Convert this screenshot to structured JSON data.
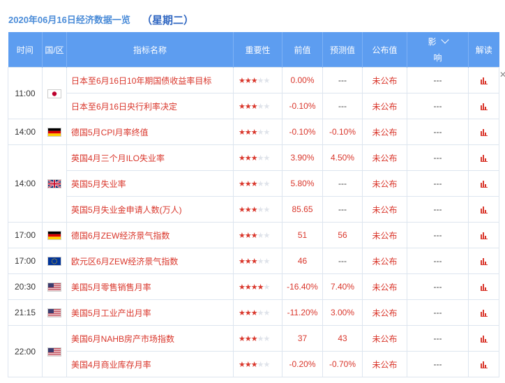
{
  "header": {
    "date": "2020年06月16日经济数据一览",
    "weekday": "（星期二）"
  },
  "columns": {
    "time": "时间",
    "country": "国/区",
    "indicator": "指标名称",
    "importance": "重要性",
    "previous": "前值",
    "forecast": "预测值",
    "actual": "公布值",
    "impact_line1": "影",
    "impact_line2": "响",
    "analysis": "解读"
  },
  "groups": [
    {
      "time": "11:00",
      "flag": "japan",
      "rows": [
        {
          "indicator": "日本至6月16日10年期国债收益率目标",
          "stars": 3,
          "previous": "0.00%",
          "forecast": "---",
          "actual": "未公布",
          "impact": "---"
        },
        {
          "indicator": "日本至6月16日央行利率决定",
          "stars": 3,
          "previous": "-0.10%",
          "forecast": "---",
          "actual": "未公布",
          "impact": "---"
        }
      ]
    },
    {
      "time": "14:00",
      "flag": "germany",
      "rows": [
        {
          "indicator": "德国5月CPI月率终值",
          "stars": 3,
          "previous": "-0.10%",
          "forecast": "-0.10%",
          "actual": "未公布",
          "impact": "---"
        }
      ]
    },
    {
      "time": "14:00",
      "flag": "uk",
      "rows": [
        {
          "indicator": "英国4月三个月ILO失业率",
          "stars": 3,
          "previous": "3.90%",
          "forecast": "4.50%",
          "actual": "未公布",
          "impact": "---"
        },
        {
          "indicator": "英国5月失业率",
          "stars": 3,
          "previous": "5.80%",
          "forecast": "---",
          "actual": "未公布",
          "impact": "---"
        },
        {
          "indicator": "英国5月失业金申请人数(万人)",
          "stars": 3,
          "previous": "85.65",
          "forecast": "---",
          "actual": "未公布",
          "impact": "---"
        }
      ]
    },
    {
      "time": "17:00",
      "flag": "germany",
      "rows": [
        {
          "indicator": "德国6月ZEW经济景气指数",
          "stars": 3,
          "previous": "51",
          "forecast": "56",
          "actual": "未公布",
          "impact": "---"
        }
      ]
    },
    {
      "time": "17:00",
      "flag": "eu",
      "rows": [
        {
          "indicator": "欧元区6月ZEW经济景气指数",
          "stars": 3,
          "previous": "46",
          "forecast": "---",
          "actual": "未公布",
          "impact": "---"
        }
      ]
    },
    {
      "time": "20:30",
      "flag": "us",
      "rows": [
        {
          "indicator": "美国5月零售销售月率",
          "stars": 4,
          "previous": "-16.40%",
          "forecast": "7.40%",
          "actual": "未公布",
          "impact": "---"
        }
      ]
    },
    {
      "time": "21:15",
      "flag": "us",
      "rows": [
        {
          "indicator": "美国5月工业产出月率",
          "stars": 3,
          "previous": "-11.20%",
          "forecast": "3.00%",
          "actual": "未公布",
          "impact": "---"
        }
      ]
    },
    {
      "time": "22:00",
      "flag": "us",
      "rows": [
        {
          "indicator": "美国6月NAHB房产市场指数",
          "stars": 3,
          "previous": "37",
          "forecast": "43",
          "actual": "未公布",
          "impact": "---"
        },
        {
          "indicator": "美国4月商业库存月率",
          "stars": 3,
          "previous": "-0.20%",
          "forecast": "-0.70%",
          "actual": "未公布",
          "impact": "---"
        }
      ]
    }
  ],
  "icons": {
    "analysis": "bar-chart-icon",
    "impact_toggle": "chevron-down-icon",
    "scroll": "close-icon"
  },
  "colors": {
    "header_bg": "#5d9df0",
    "accent_red": "#d9362b",
    "date_blue": "#4b8cd8"
  }
}
